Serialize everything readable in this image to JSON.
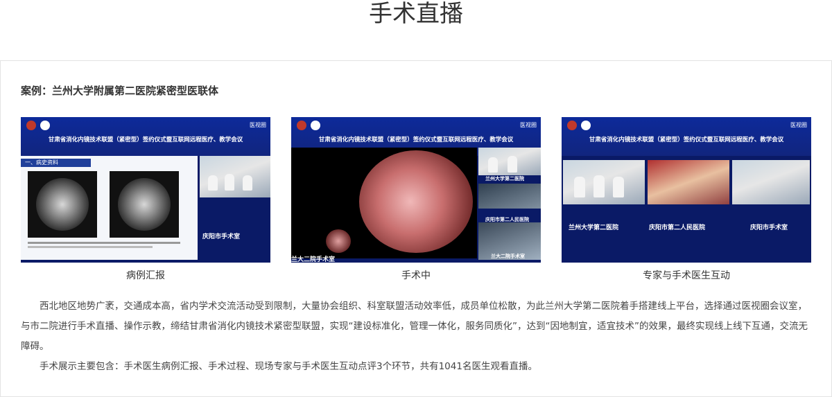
{
  "page": {
    "title": "手术直播"
  },
  "case": {
    "title": "案例：兰州大学附属第二医院紧密型医联体"
  },
  "screens": [
    {
      "caption": "病例汇报",
      "banner": "甘肃省消化内镜技术联盟（紧密型）签约仪式暨互联网远程医疗、教学会议",
      "slide_heading": "一、病史资料",
      "tag": "庆阳市手术室",
      "logo_text": "医视圈"
    },
    {
      "caption": "手术中",
      "banner": "甘肃省消化内镜技术联盟（紧密型）签约仪式暨互联网远程医疗、教学会议",
      "tags": [
        "兰州大学第二医院",
        "庆阳市第二人民医院",
        "兰大二院手术室",
        "兰大二院手术室"
      ],
      "logo_text": "医视圈"
    },
    {
      "caption": "专家与手术医生互动",
      "banner": "甘肃省消化内镜技术联盟（紧密型）签约仪式暨互联网远程医疗、教学会议",
      "tags": [
        "兰州大学第二医院",
        "庆阳市第二人民医院",
        "庆阳市手术室"
      ],
      "logo_text": "医视圈"
    }
  ],
  "description": {
    "paragraph1": "西北地区地势广袤，交通成本高，省内学术交流活动受到限制，大量协会组织、科室联盟活动效率低，成员单位松散，为此兰州大学第二医院着手搭建线上平台，选择通过医视圈会议室，与市二院进行手术直播、操作示教，缔结甘肃省消化内镜技术紧密型联盟，实现“建设标准化，管理一体化，服务同质化”，达到“因地制宜，适宜技术”的效果，最终实现线上线下互通，交流无障碍。",
    "paragraph2": "手术展示主要包含：手术医生病例汇报、手术过程、现场专家与手术医生互动点评3个环节，共有1041名医生观看直播。"
  },
  "colors": {
    "screen_bg": "#0a1a66",
    "screen_header": "#0d2a9a",
    "border": "#e3e3e3"
  }
}
